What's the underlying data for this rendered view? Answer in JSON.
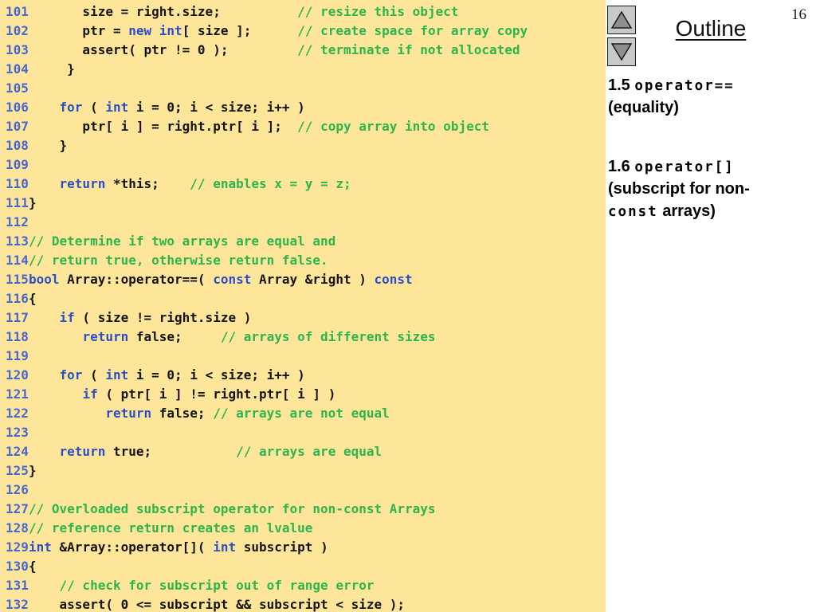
{
  "colors": {
    "code-bg": "#FDE59A",
    "code-black": "#141414",
    "keyword-blue": "#2C4EC8",
    "line-number-blue": "#4A66D0",
    "comment-green": "#2EB44E",
    "button-face": "#C9C9C9",
    "button-border": "#1A1A1A",
    "arrow-fill": "#8E8E8E"
  },
  "code": {
    "lines": [
      {
        "n": "101",
        "s": [
          [
            "x",
            "       size = right.size;          "
          ],
          [
            "c",
            "// resize this object"
          ]
        ]
      },
      {
        "n": "102",
        "s": [
          [
            "x",
            "       ptr = "
          ],
          [
            "k",
            "new"
          ],
          [
            "x",
            " "
          ],
          [
            "k",
            "int"
          ],
          [
            "x",
            "[ size ];      "
          ],
          [
            "c",
            "// create space for array copy"
          ]
        ]
      },
      {
        "n": "103",
        "s": [
          [
            "x",
            "       assert( ptr != 0 );         "
          ],
          [
            "c",
            "// terminate if not allocated"
          ]
        ]
      },
      {
        "n": "104",
        "s": [
          [
            "x",
            "     }"
          ]
        ]
      },
      {
        "n": "105",
        "s": []
      },
      {
        "n": "106",
        "s": [
          [
            "x",
            "    "
          ],
          [
            "k",
            "for"
          ],
          [
            "x",
            " ( "
          ],
          [
            "k",
            "int"
          ],
          [
            "x",
            " i = 0; i < size; i++ )"
          ]
        ]
      },
      {
        "n": "107",
        "s": [
          [
            "x",
            "       ptr[ i ] = right.ptr[ i ];  "
          ],
          [
            "c",
            "// copy array into object"
          ]
        ]
      },
      {
        "n": "108",
        "s": [
          [
            "x",
            "    }"
          ]
        ]
      },
      {
        "n": "109",
        "s": []
      },
      {
        "n": "110",
        "s": [
          [
            "x",
            "    "
          ],
          [
            "k",
            "return"
          ],
          [
            "x",
            " *this;    "
          ],
          [
            "c",
            "// enables x = y = z;"
          ]
        ]
      },
      {
        "n": "111",
        "s": [
          [
            "x",
            "}"
          ]
        ]
      },
      {
        "n": "112",
        "s": []
      },
      {
        "n": "113",
        "s": [
          [
            "c",
            "// Determine if two arrays are equal and"
          ]
        ]
      },
      {
        "n": "114",
        "s": [
          [
            "c",
            "// return true, otherwise return false."
          ]
        ]
      },
      {
        "n": "115",
        "s": [
          [
            "k",
            "bool"
          ],
          [
            "x",
            " Array::operator==( "
          ],
          [
            "k",
            "const"
          ],
          [
            "x",
            " Array &right ) "
          ],
          [
            "k",
            "const"
          ]
        ]
      },
      {
        "n": "116",
        "s": [
          [
            "x",
            "{"
          ]
        ]
      },
      {
        "n": "117",
        "s": [
          [
            "x",
            "    "
          ],
          [
            "k",
            "if"
          ],
          [
            "x",
            " ( size != right.size )"
          ]
        ]
      },
      {
        "n": "118",
        "s": [
          [
            "x",
            "       "
          ],
          [
            "k",
            "return"
          ],
          [
            "x",
            " false;     "
          ],
          [
            "c",
            "// arrays of different sizes"
          ]
        ]
      },
      {
        "n": "119",
        "s": []
      },
      {
        "n": "120",
        "s": [
          [
            "x",
            "    "
          ],
          [
            "k",
            "for"
          ],
          [
            "x",
            " ( "
          ],
          [
            "k",
            "int"
          ],
          [
            "x",
            " i = 0; i < size; i++ )"
          ]
        ]
      },
      {
        "n": "121",
        "s": [
          [
            "x",
            "       "
          ],
          [
            "k",
            "if"
          ],
          [
            "x",
            " ( ptr[ i ] != right.ptr[ i ] )"
          ]
        ]
      },
      {
        "n": "122",
        "s": [
          [
            "x",
            "          "
          ],
          [
            "k",
            "return"
          ],
          [
            "x",
            " false; "
          ],
          [
            "c",
            "// arrays are not equal"
          ]
        ]
      },
      {
        "n": "123",
        "s": []
      },
      {
        "n": "124",
        "s": [
          [
            "x",
            "    "
          ],
          [
            "k",
            "return"
          ],
          [
            "x",
            " true;           "
          ],
          [
            "c",
            "// arrays are equal"
          ]
        ]
      },
      {
        "n": "125",
        "s": [
          [
            "x",
            "}"
          ]
        ]
      },
      {
        "n": "126",
        "s": []
      },
      {
        "n": "127",
        "s": [
          [
            "c",
            "// Overloaded subscript operator for non-const Arrays"
          ]
        ]
      },
      {
        "n": "128",
        "s": [
          [
            "c",
            "// reference return creates an lvalue"
          ]
        ]
      },
      {
        "n": "129",
        "s": [
          [
            "k",
            "int"
          ],
          [
            "x",
            " &Array::operator[]( "
          ],
          [
            "k",
            "int"
          ],
          [
            "x",
            " subscript )"
          ]
        ]
      },
      {
        "n": "130",
        "s": [
          [
            "x",
            "{"
          ]
        ]
      },
      {
        "n": "131",
        "s": [
          [
            "x",
            "    "
          ],
          [
            "c",
            "// check for subscript out of range error"
          ]
        ]
      },
      {
        "n": "132",
        "s": [
          [
            "x",
            "    assert( 0 <= subscript && subscript < size );"
          ]
        ]
      }
    ]
  },
  "outline": {
    "page_number": "16",
    "title": "Outline",
    "items": [
      {
        "lines": [
          [
            {
              "t": "1.5 ",
              "f": "s"
            },
            {
              "t": "operator==",
              "f": "m"
            }
          ],
          [
            {
              "t": "(equality)",
              "f": "s"
            }
          ]
        ]
      },
      {
        "lines": [
          [
            {
              "t": "1.6 ",
              "f": "s"
            },
            {
              "t": "operator[]",
              "f": "m"
            }
          ],
          [
            {
              "t": "(subscript for non-",
              "f": "s"
            }
          ],
          [
            {
              "t": "const",
              "f": "m"
            },
            {
              "t": " arrays)",
              "f": "s"
            }
          ]
        ]
      }
    ]
  }
}
